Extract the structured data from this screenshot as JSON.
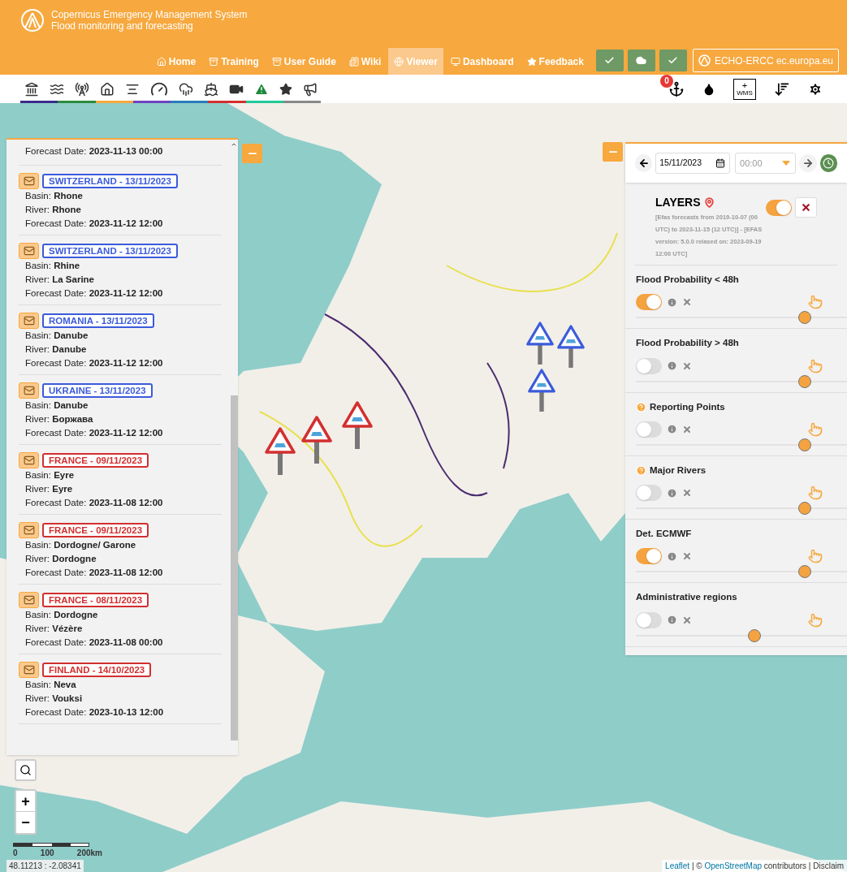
{
  "header": {
    "title": "Copernicus Emergency Management System",
    "subtitle": "Flood monitoring and forecasting"
  },
  "nav": [
    {
      "label": "Home",
      "kind": "home",
      "selected": false
    },
    {
      "label": "Training",
      "kind": "box",
      "selected": false
    },
    {
      "label": "User Guide",
      "kind": "box",
      "selected": false
    },
    {
      "label": "Wiki",
      "kind": "paper",
      "selected": false
    },
    {
      "label": "Viewer",
      "kind": "globe",
      "selected": true
    },
    {
      "label": "Dashboard",
      "kind": "monitor",
      "selected": false
    },
    {
      "label": "Feedback",
      "kind": "star",
      "selected": false
    }
  ],
  "header_buttons": [
    {
      "kind": "check"
    },
    {
      "kind": "cloud"
    },
    {
      "kind": "check"
    }
  ],
  "echo_link": "ECHO-ERCC ec.europa.eu",
  "toolbar": {
    "notification_count": "0",
    "wms_plus": "+",
    "wms_label": "WMS"
  },
  "alerts": {
    "partial_date": "Forecast Date: **2023-11-13 00:00**",
    "items": [
      {
        "title": "SWITZERLAND - 13/11/2023",
        "color": "#3b5bdb",
        "basin": "Basin: **Rhone**",
        "river": "River: **Rhone**",
        "forecast": "Forecast Date: **2023-11-12 12:00**"
      },
      {
        "title": "SWITZERLAND - 13/11/2023",
        "color": "#3b5bdb",
        "basin": "Basin: **Rhine**",
        "river": "River: **La Sarine**",
        "forecast": "Forecast Date: **2023-11-12 12:00**"
      },
      {
        "title": "ROMANIA - 13/11/2023",
        "color": "#3b5bdb",
        "basin": "Basin: **Danube**",
        "river": "River: **Danube**",
        "forecast": "Forecast Date: **2023-11-12 12:00**"
      },
      {
        "title": "UKRAINE - 13/11/2023",
        "color": "#3b5bdb",
        "basin": "Basin: **Danube**",
        "river": "River: **Боржава**",
        "forecast": "Forecast Date: **2023-11-12 12:00**"
      },
      {
        "title": "FRANCE - 09/11/2023",
        "color": "#d32f2f",
        "basin": "Basin: **Eyre**",
        "river": "River: **Eyre**",
        "forecast": "Forecast Date: **2023-11-08 12:00**"
      },
      {
        "title": "FRANCE - 09/11/2023",
        "color": "#d32f2f",
        "basin": "Basin: **Dordogne/ Garone**",
        "river": "River: **Dordogne**",
        "forecast": "Forecast Date: **2023-11-08 12:00**"
      },
      {
        "title": "FRANCE - 08/11/2023",
        "color": "#d32f2f",
        "basin": "Basin: **Dordogne**",
        "river": "River: **Vézère**",
        "forecast": "Forecast Date: **2023-11-08 00:00**"
      },
      {
        "title": "FINLAND - 14/10/2023",
        "color": "#d32f2f",
        "basin": "Basin: **Neva**",
        "river": "River: **Vouksi**",
        "forecast": "Forecast Date: **2023-10-13 12:00**"
      }
    ]
  },
  "map_markers": [
    {
      "color": "#d32f2f"
    },
    {
      "color": "#d32f2f"
    },
    {
      "color": "#d32f2f"
    },
    {
      "color": "#3b5bdb"
    },
    {
      "color": "#3b5bdb"
    },
    {
      "color": "#3b5bdb"
    }
  ],
  "time_panel": {
    "date": "15/11/2023",
    "time": "00:00"
  },
  "layers": {
    "title": "LAYERS",
    "description": "[Efas forecasts from 2019-10-07 (00 UTC) to 2023-11-15 (12 UTC)] - [EFAS version: 5.0.0 relased on: 2023-09-19 12:00 UTC]",
    "on": true,
    "items": [
      {
        "name": "Flood Probability < 48h",
        "help": false,
        "on": true,
        "level": 0.8
      },
      {
        "name": "Flood Probability > 48h",
        "help": false,
        "on": false,
        "level": 0.8
      },
      {
        "name": "Reporting Points",
        "help": true,
        "on": false,
        "level": 0.8
      },
      {
        "name": "Major Rivers",
        "help": true,
        "on": false,
        "level": 0.8
      },
      {
        "name": "Det. ECMWF",
        "help": false,
        "on": true,
        "level": 0.8
      },
      {
        "name": "Administrative regions",
        "help": false,
        "on": false,
        "level": 0.56
      }
    ]
  },
  "map_controls": {
    "zoom_in": "+",
    "zoom_out": "−"
  },
  "map_footer": {
    "scale": [
      "0",
      "100",
      "200km"
    ],
    "coordinates": "48.11213 : -2.08341",
    "attribution_links": [
      "Leaflet",
      "OpenStreetMap"
    ],
    "attribution_sep": " | © ",
    "attribution_rest": " contributors | Disclaim"
  }
}
